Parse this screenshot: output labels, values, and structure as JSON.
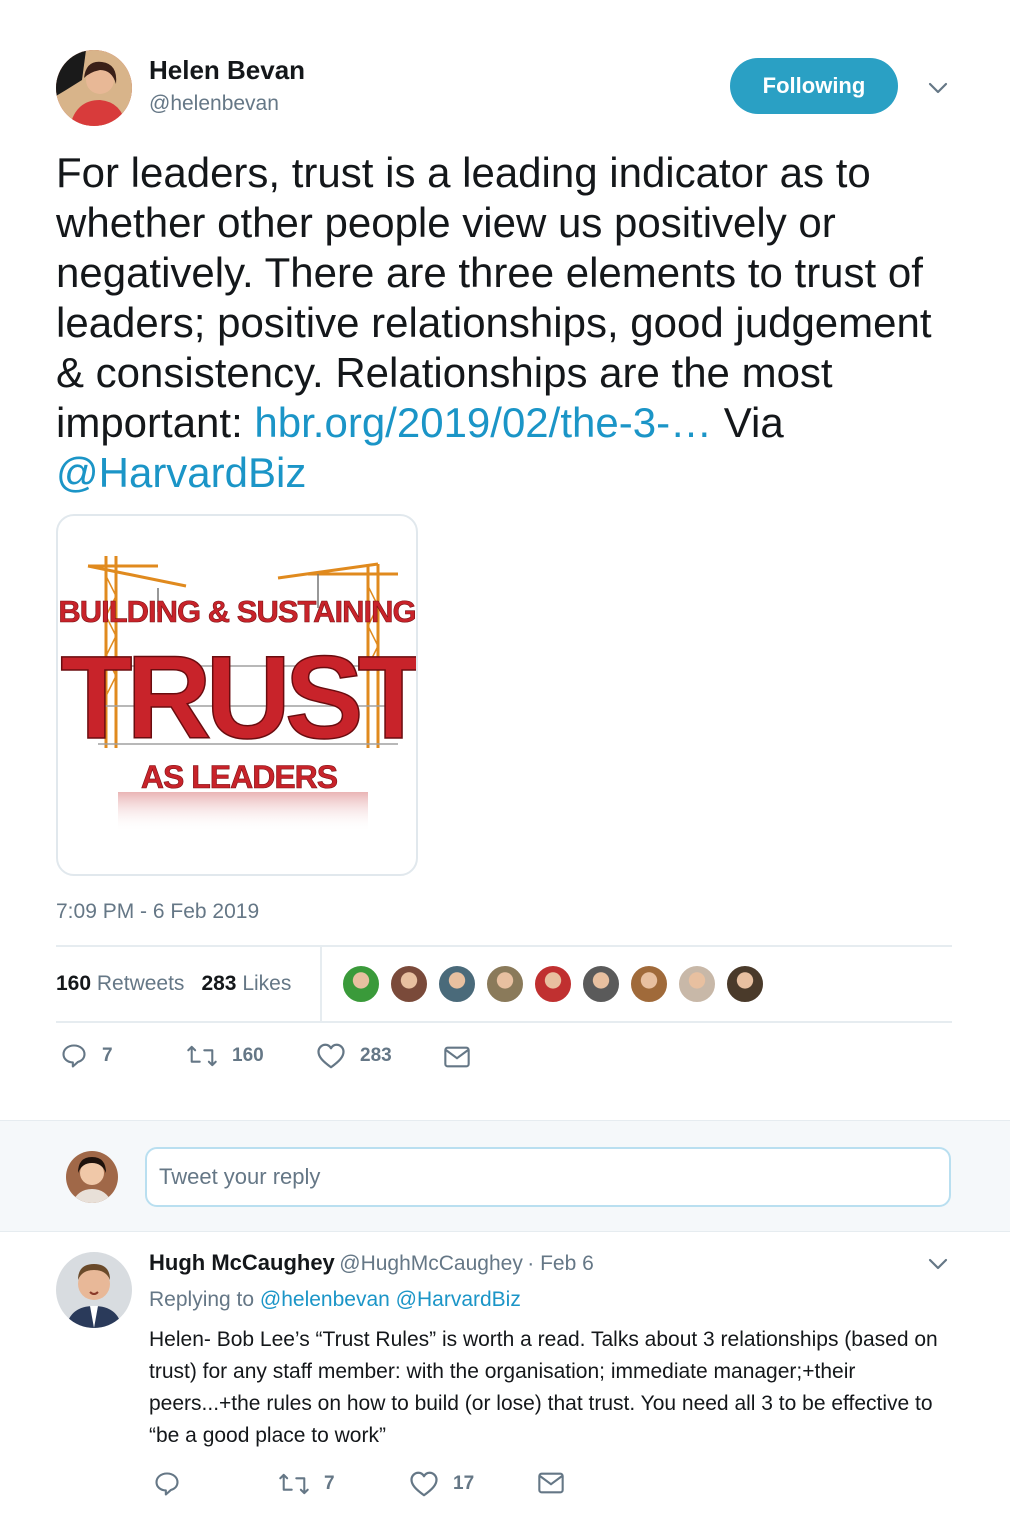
{
  "tweet": {
    "author_name": "Helen Bevan",
    "author_handle": "@helenbevan",
    "follow_label": "Following",
    "text_before_link": "For leaders, trust is a leading indicator as to whether other people view us positively or negatively. There are three elements to trust of leaders; positive relationships, good judgement & consistency. Relationships are the most important: ",
    "link_text": "hbr.org/2019/02/the-3-…",
    "via_text": " Via ",
    "mention": "@HarvardBiz",
    "image": {
      "line1": "BUILDING & SUSTAINING",
      "line2": "TRUST",
      "line3": "AS LEADERS"
    },
    "timestamp": "7:09 PM - 6 Feb 2019",
    "retweets_count": "160",
    "retweets_label": "Retweets",
    "likes_count": "283",
    "likes_label": "Likes",
    "actions": {
      "reply_count": "7",
      "retweet_count": "160",
      "like_count": "283"
    },
    "liker_avatar_colors": [
      "#3a9a3a",
      "#7a4a3a",
      "#4a6a7a",
      "#8a7a5a",
      "#c03030",
      "#5a5a5a",
      "#a06a3a",
      "#c8b8a8",
      "#4a3a2a"
    ]
  },
  "reply_composer": {
    "placeholder": "Tweet your reply"
  },
  "reply": {
    "author_name": "Hugh McCaughey",
    "author_handle": "@HughMcCaughey",
    "date": "· Feb 6",
    "replying_to_label": "Replying to ",
    "replying_to_1": "@helenbevan",
    "replying_to_2": "@HarvardBiz",
    "text": "Helen- Bob Lee’s “Trust Rules” is worth a read. Talks about 3 relationships (based on trust) for any staff member: with the organisation; immediate manager;+their peers...+the rules on how to build (or lose) that trust. You need all 3 to be effective to “be a good place to work”",
    "actions": {
      "retweet_count": "7",
      "like_count": "17"
    }
  },
  "colors": {
    "accent": "#1b95c7",
    "follow_button": "#2aa0c4",
    "muted": "#657786"
  }
}
